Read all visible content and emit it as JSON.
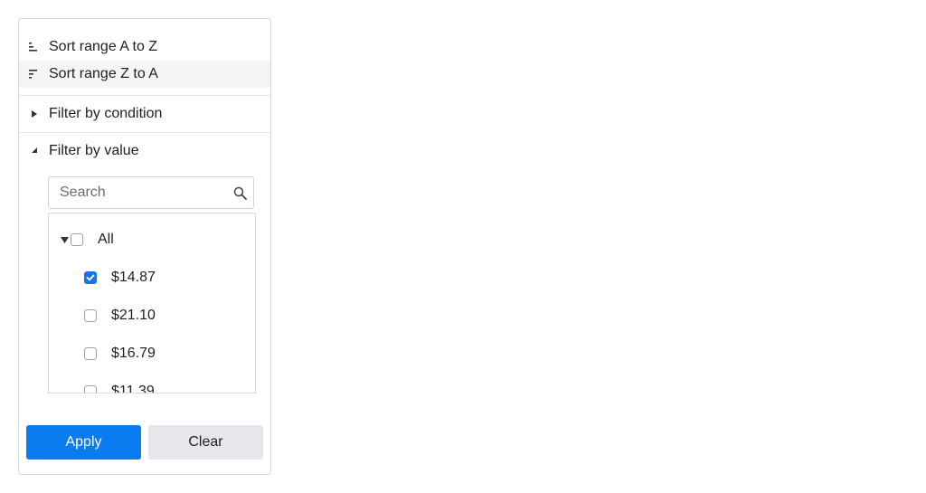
{
  "sort": {
    "asc_label": "Sort range A to Z",
    "desc_label": "Sort range Z to A"
  },
  "filter_condition": {
    "label": "Filter by condition",
    "expanded": false
  },
  "filter_value": {
    "label": "Filter by value",
    "expanded": true,
    "search": {
      "placeholder": "Search",
      "value": ""
    },
    "all_label": "All",
    "items": [
      {
        "label": "$14.87",
        "checked": true
      },
      {
        "label": "$21.10",
        "checked": false
      },
      {
        "label": "$16.79",
        "checked": false
      },
      {
        "label": "$11.39",
        "checked": false
      }
    ]
  },
  "actions": {
    "apply_label": "Apply",
    "clear_label": "Clear"
  },
  "colors": {
    "accent": "#0a7cf0",
    "checkbox_checked": "#1a73e8",
    "secondary_button": "#e5e7eb"
  }
}
